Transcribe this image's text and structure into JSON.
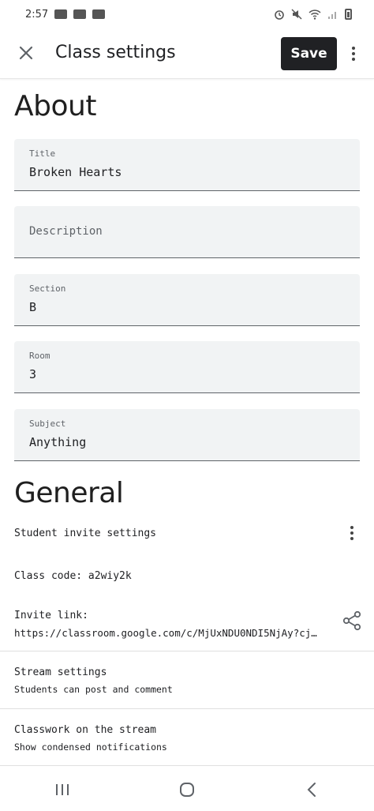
{
  "status_bar": {
    "time": "2:57"
  },
  "app_bar": {
    "title": "Class settings",
    "save_label": "Save"
  },
  "about": {
    "heading": "About",
    "fields": {
      "title": {
        "label": "Title",
        "value": "Broken Hearts"
      },
      "description": {
        "placeholder": "Description"
      },
      "section": {
        "label": "Section",
        "value": "B"
      },
      "room": {
        "label": "Room",
        "value": "3"
      },
      "subject": {
        "label": "Subject",
        "value": "Anything"
      }
    }
  },
  "general": {
    "heading": "General",
    "student_invite_settings": "Student invite settings",
    "class_code": "Class code: a2wiy2k",
    "invite_link_label": "Invite link:",
    "invite_link_url": "https://classroom.google.com/c/MjUxNDU0NDI5NjAy?cj…",
    "stream_settings_title": "Stream settings",
    "stream_settings_sub": "Students can post and comment",
    "classwork_stream_title": "Classwork on the stream",
    "classwork_stream_sub": "Show condensed notifications"
  },
  "colors": {
    "save_button_bg": "#202124",
    "field_bg": "#f1f3f4"
  }
}
